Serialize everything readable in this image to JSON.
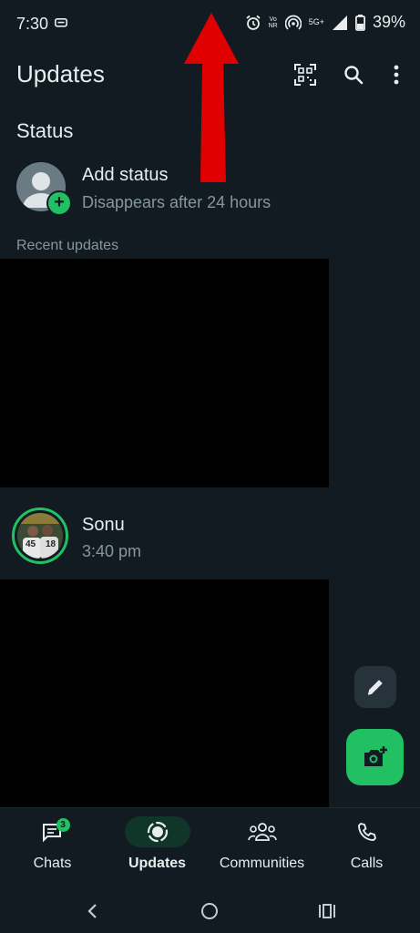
{
  "status_bar": {
    "time": "7:30",
    "network_top": "Vo",
    "network_bottom": "NR",
    "network_type": "5G+",
    "battery_percent": "39%"
  },
  "app_bar": {
    "title": "Updates",
    "icons": [
      "qr-scanner-icon",
      "search-icon",
      "more-vert-icon"
    ]
  },
  "status_section": {
    "heading": "Status",
    "my_status": {
      "title": "Add status",
      "subtitle": "Disappears after 24 hours"
    },
    "recent_heading": "Recent updates",
    "updates": [
      {
        "name": "Sonu",
        "time": "3:40 pm",
        "photo_numbers": [
          "45",
          "18"
        ]
      }
    ]
  },
  "fabs": {
    "small": "pencil-icon",
    "large": "camera-add-icon"
  },
  "bottom_nav": {
    "items": [
      {
        "label": "Chats",
        "badge": "3",
        "icon": "chats-icon"
      },
      {
        "label": "Updates",
        "active": true,
        "icon": "updates-icon"
      },
      {
        "label": "Communities",
        "icon": "communities-icon"
      },
      {
        "label": "Calls",
        "icon": "phone-icon"
      }
    ]
  },
  "colors": {
    "background": "#111b21",
    "accent": "#21c063",
    "text_primary": "#e9edef",
    "text_secondary": "#8696a0",
    "annotation_arrow": "#e00000"
  }
}
